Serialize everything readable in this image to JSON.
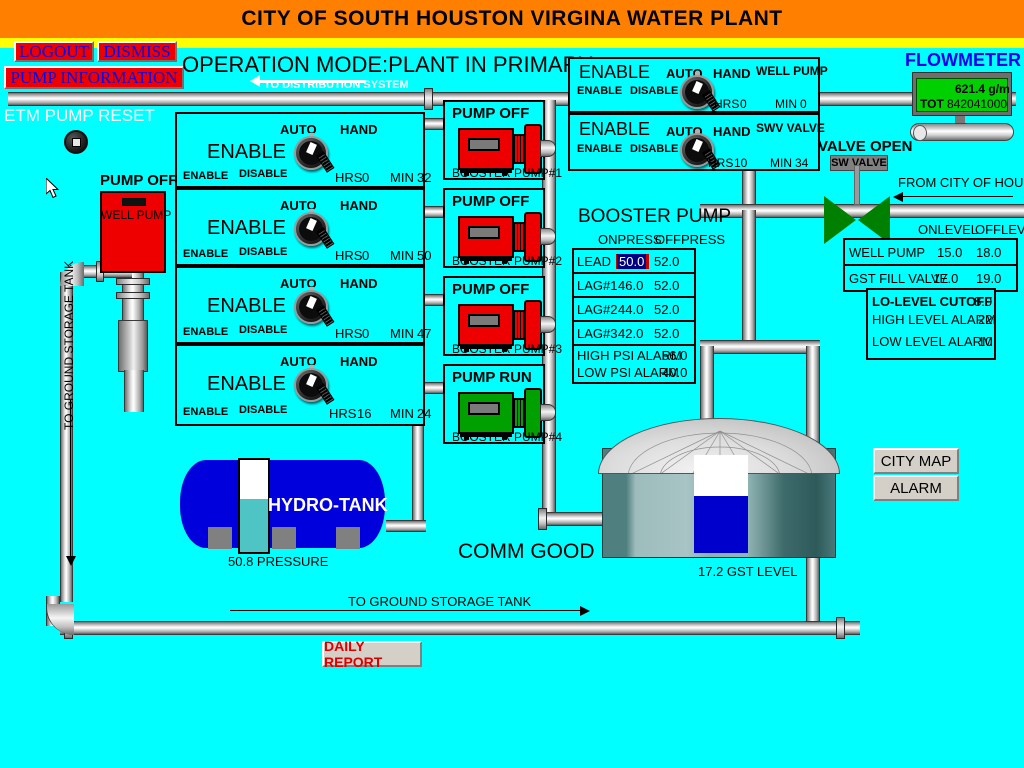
{
  "header": {
    "title": "CITY OF SOUTH HOUSTON VIRGINA WATER PLANT",
    "operation_mode": "OPERATION MODE:PLANT IN PRIMARY"
  },
  "commands": {
    "logout": "LOGOUT",
    "dismiss": "DISMISS",
    "pump_information": "PUMP INFORMATION",
    "city_map": "CITY MAP",
    "alarm": "ALARM",
    "daily_report": "DAILY REPORT"
  },
  "annotations": {
    "to_distribution_system": "TO DISTRIBUTION SYSTEM",
    "to_ground_storage_tank_vertical": "TO GROUND STORAGE TANK",
    "to_ground_storage_tank_bottom": "TO GROUND STORAGE TANK",
    "from_city_of_houston": "FROM CITY OF HOUSTON",
    "comm_status": "COMM GOOD",
    "etm_pump_reset": "ETM PUMP RESET"
  },
  "well_pump": {
    "status": "PUMP OFF",
    "label": "WELL PUMP",
    "running": false
  },
  "booster_pumps": [
    {
      "status": "PUMP OFF",
      "name": "BOOSTER PUMP#1",
      "running": false
    },
    {
      "status": "PUMP OFF",
      "name": "BOOSTER PUMP#2",
      "running": false
    },
    {
      "status": "PUMP OFF",
      "name": "BOOSTER PUMP#3",
      "running": false
    },
    {
      "status": "PUMP RUN",
      "name": "BOOSTER PUMP#4",
      "running": true
    }
  ],
  "booster_controls": [
    {
      "state": "ENABLE",
      "auto": "AUTO",
      "hand": "HAND",
      "enable": "ENABLE",
      "disable": "DISABLE",
      "hrs_label": "HRS",
      "hrs": "0",
      "min_label": "MIN",
      "min": "32"
    },
    {
      "state": "ENABLE",
      "auto": "AUTO",
      "hand": "HAND",
      "enable": "ENABLE",
      "disable": "DISABLE",
      "hrs_label": "HRS",
      "hrs": "0",
      "min_label": "MIN",
      "min": "50"
    },
    {
      "state": "ENABLE",
      "auto": "AUTO",
      "hand": "HAND",
      "enable": "ENABLE",
      "disable": "DISABLE",
      "hrs_label": "HRS",
      "hrs": "0",
      "min_label": "MIN",
      "min": "47"
    },
    {
      "state": "ENABLE",
      "auto": "AUTO",
      "hand": "HAND",
      "enable": "ENABLE",
      "disable": "DISABLE",
      "hrs_label": "HRS",
      "hrs": "16",
      "min_label": "MIN",
      "min": "24"
    }
  ],
  "top_controls": [
    {
      "state": "ENABLE",
      "auto": "AUTO",
      "hand": "HAND",
      "device": "WELL PUMP",
      "enable": "ENABLE",
      "disable": "DISABLE",
      "hrs_label": "HRS",
      "hrs": "0",
      "min_label": "MIN",
      "min": "0"
    },
    {
      "state": "ENABLE",
      "auto": "AUTO",
      "hand": "HAND",
      "device": "SWV VALVE",
      "enable": "ENABLE",
      "disable": "DISABLE",
      "hrs_label": "HRS",
      "hrs": "10",
      "min_label": "MIN",
      "min": "34"
    }
  ],
  "booster_pressure": {
    "title": "BOOSTER PUMP",
    "col_on": "ONPRESS",
    "col_off": "OFFPRESS",
    "rows": [
      {
        "label": "LEAD",
        "on": "50.0",
        "off": "52.0",
        "selected": true
      },
      {
        "label": "LAG#1",
        "on": "46.0",
        "off": "52.0",
        "selected": false
      },
      {
        "label": "LAG#2",
        "on": "44.0",
        "off": "52.0",
        "selected": false
      },
      {
        "label": "LAG#3",
        "on": "42.0",
        "off": "52.0",
        "selected": false
      }
    ],
    "alarms": [
      {
        "label": "HIGH PSI ALARM",
        "value": "56.0"
      },
      {
        "label": "LOW PSI ALARM",
        "value": "40.0"
      }
    ]
  },
  "levels": {
    "col_on": "ONLEVEL",
    "col_off": "OFFLEVEL",
    "rows": [
      {
        "label": "WELL PUMP",
        "on": "15.0",
        "off": "18.0"
      },
      {
        "label": "GST FILL VALVE",
        "on": "17.0",
        "off": "19.0"
      }
    ],
    "alarms": [
      {
        "label": "LO-LEVEL CUTOFF",
        "value": "8.0",
        "bold": true
      },
      {
        "label": "HIGH LEVEL ALARM",
        "value": "22",
        "bold": false
      },
      {
        "label": "LOW LEVEL ALARM",
        "value": "10",
        "bold": false
      }
    ]
  },
  "flowmeter": {
    "title": "FLOWMETER",
    "rate": "621.4 g/m",
    "total_label": "TOT",
    "total": "842041000"
  },
  "valve": {
    "status": "VALVE OPEN",
    "tag": "SW VALVE",
    "open": true
  },
  "hydro_tank": {
    "name": "HYDRO-TANK",
    "pressure_text": "50.8 PRESSURE",
    "fill_percent": 58
  },
  "gst": {
    "level_text": "17.2  GST LEVEL",
    "fill_percent": 58
  },
  "colors": {
    "background": "#00ffff",
    "title_bar": "#ff8000",
    "accent_yellow": "#ffff00",
    "pump_off": "#ee0000",
    "pump_run": "#00a000",
    "valve_open": "#008000",
    "flow_display": "#00d000",
    "tank_water": "#0000cc",
    "button_red": "#ee0000",
    "button_text_blue": "#0000ee"
  }
}
